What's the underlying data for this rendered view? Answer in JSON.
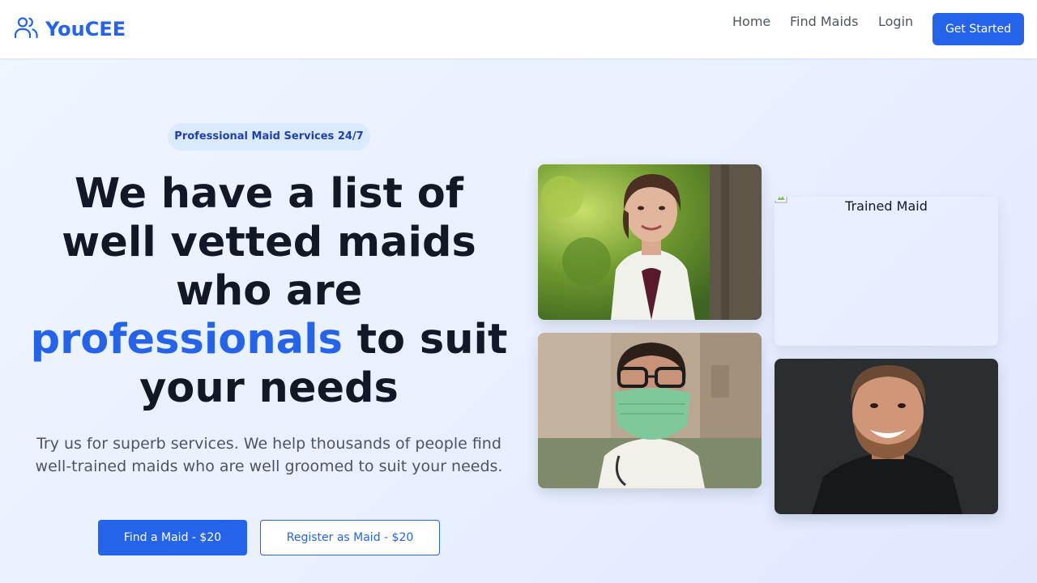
{
  "brand": {
    "name": "YouCEE",
    "icon": "users-icon",
    "color": "#2563eb"
  },
  "nav": {
    "links": [
      {
        "label": "Home"
      },
      {
        "label": "Find Maids"
      },
      {
        "label": "Login"
      }
    ],
    "cta_label": "Get Started"
  },
  "hero": {
    "badge": "Professional Maid Services 24/7",
    "headline": {
      "part1": "We have a list of",
      "part2": "well vetted maids",
      "part3": "who are",
      "accent": "professionals",
      "part4": " to suit",
      "part5": "your needs"
    },
    "subtext": "Try us for superb services. We help thousands of people find well-trained maids who are well groomed to suit your needs.",
    "primary_button": "Find a Maid - $20",
    "secondary_button": "Register as Maid - $20"
  },
  "gallery": {
    "broken_image_alt": "Trained Maid",
    "images": [
      "woman-in-white-coat-photo",
      "man-in-face-mask-photo",
      "smiling-bearded-man-photo"
    ]
  },
  "colors": {
    "accent": "#2563eb",
    "badge_bg": "#dbeafe",
    "badge_text": "#1e40af",
    "heading": "#111827",
    "body_text": "#4b5563"
  }
}
